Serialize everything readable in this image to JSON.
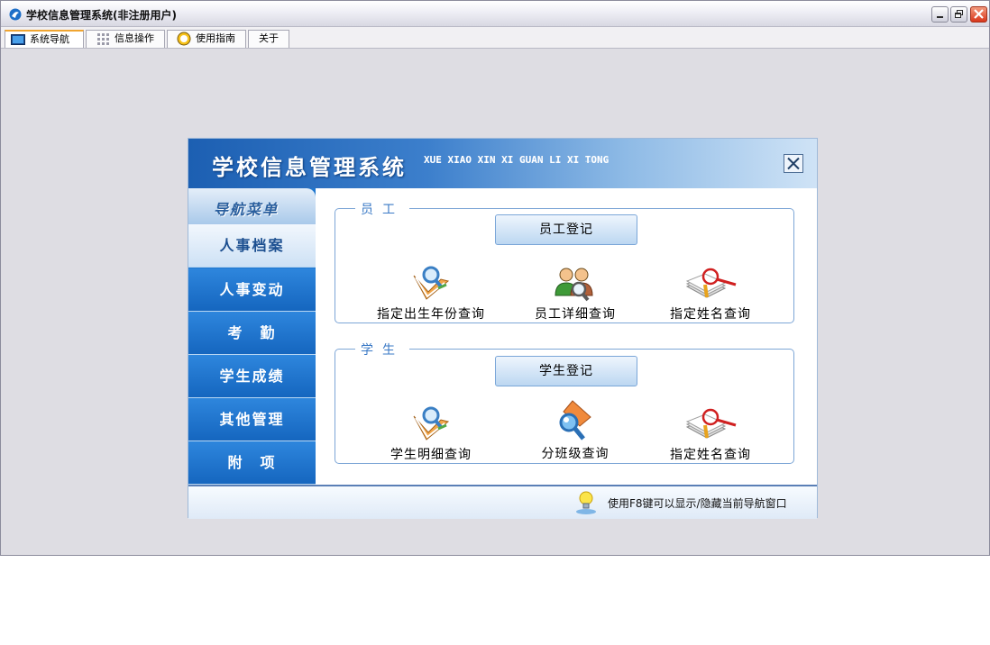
{
  "window": {
    "title": "学校信息管理系统(非注册用户)"
  },
  "tabs": [
    {
      "label": "系统导航",
      "icon": "monitor-icon",
      "active": true
    },
    {
      "label": "信息操作",
      "icon": "grid-icon",
      "active": false
    },
    {
      "label": "使用指南",
      "icon": "help-icon",
      "active": false
    },
    {
      "label": "关于",
      "icon": "",
      "active": false
    }
  ],
  "nav": {
    "title": "学校信息管理系统",
    "pinyin": "XUE XIAO XIN XI GUAN LI XI TONG",
    "menu_header": "导航菜单",
    "menu": [
      {
        "label": "人事档案",
        "active": true
      },
      {
        "label": "人事变动",
        "active": false
      },
      {
        "label": "考　勤",
        "active": false
      },
      {
        "label": "学生成绩",
        "active": false
      },
      {
        "label": "其他管理",
        "active": false
      },
      {
        "label": "附　项",
        "active": false
      }
    ],
    "staff": {
      "legend": "员工",
      "register": "员工登记",
      "queries": [
        {
          "label": "指定出生年份查询",
          "icon": "magnifier-book-icon"
        },
        {
          "label": "员工详细查询",
          "icon": "people-search-icon"
        },
        {
          "label": "指定姓名查询",
          "icon": "document-search-icon"
        }
      ]
    },
    "student": {
      "legend": "学生",
      "register": "学生登记",
      "queries": [
        {
          "label": "学生明细查询",
          "icon": "magnifier-book-icon"
        },
        {
          "label": "分班级查询",
          "icon": "magnifier-orange-icon"
        },
        {
          "label": "指定姓名查询",
          "icon": "document-search-icon"
        }
      ]
    },
    "status_hint": "使用F8键可以显示/隐藏当前导航窗口"
  },
  "colors": {
    "accent_blue": "#1f77cf",
    "border_blue": "#7da6d6",
    "legend_blue": "#3a79c6",
    "tab_active_top": "#f0a530",
    "close_red": "#d9361b"
  }
}
